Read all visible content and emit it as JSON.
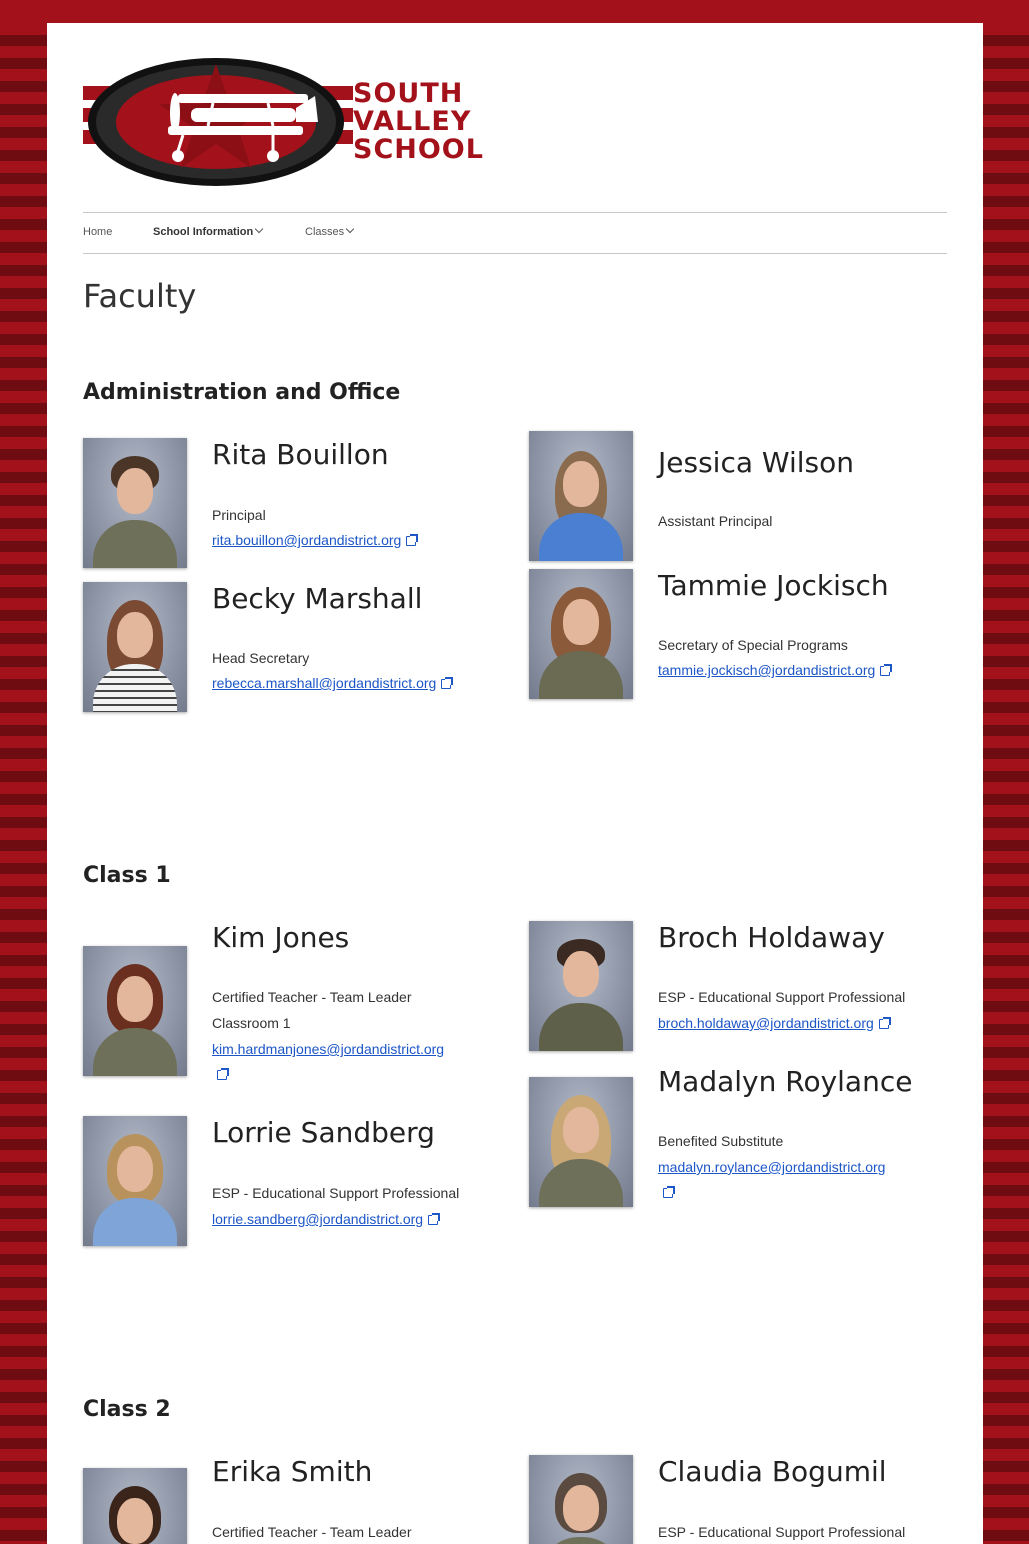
{
  "logo": {
    "lines": [
      "SOUTH",
      "VALLEY",
      "SCHOOL"
    ]
  },
  "nav": {
    "home": "Home",
    "school_info": "School Information",
    "classes": "Classes"
  },
  "page_title": "Faculty",
  "sections": {
    "admin": {
      "title": "Administration and Office",
      "people": {
        "rita": {
          "name": "Rita Bouillon",
          "role": "Principal",
          "email": "rita.bouillon@jordandistrict.org"
        },
        "jessica": {
          "name": "Jessica Wilson",
          "role": "Assistant Principal"
        },
        "becky": {
          "name": "Becky Marshall",
          "role": "Head Secretary",
          "email": "rebecca.marshall@jordandistrict.org"
        },
        "tammie": {
          "name": "Tammie Jockisch",
          "role": "Secretary of Special Programs",
          "email": "tammie.jockisch@jordandistrict.org"
        }
      }
    },
    "class1": {
      "title": "Class 1",
      "people": {
        "kim": {
          "name": "Kim Jones",
          "role": "Certified Teacher - Team Leader",
          "role2": "Classroom 1",
          "email": "kim.hardmanjones@jordandistrict.org"
        },
        "broch": {
          "name": "Broch Holdaway",
          "role": "ESP - Educational Support Professional",
          "email": "broch.holdaway@jordandistrict.org"
        },
        "lorrie": {
          "name": "Lorrie Sandberg",
          "role": "ESP - Educational Support Professional",
          "email": "lorrie.sandberg@jordandistrict.org"
        },
        "madalyn": {
          "name": "Madalyn Roylance",
          "role": "Benefited Substitute",
          "email": "madalyn.roylance@jordandistrict.org"
        }
      }
    },
    "class2": {
      "title": "Class 2",
      "people": {
        "erika": {
          "name": "Erika Smith",
          "role": "Certified Teacher - Team Leader"
        },
        "claudia": {
          "name": "Claudia Bogumil",
          "role": "ESP - Educational Support Professional"
        }
      }
    }
  },
  "colors": {
    "brand_red": "#a3121a",
    "link": "#1c56c7"
  }
}
